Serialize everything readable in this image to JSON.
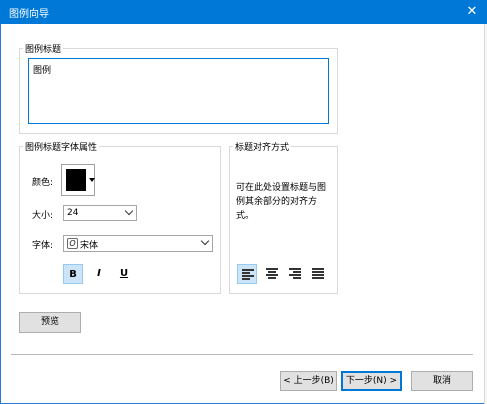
{
  "window": {
    "title": "图例向导",
    "close_icon": "close-icon"
  },
  "legend_title": {
    "group_label": "图例标题",
    "text_value": "图例"
  },
  "font_props": {
    "group_label": "图例标题字体属性",
    "color_label": "颜色:",
    "color_value": "#000000",
    "size_label": "大小:",
    "size_value": "24",
    "font_label": "字体:",
    "font_value": "宋体",
    "bold_label": "B",
    "italic_label": "I",
    "underline_label": "U",
    "bold_active": true
  },
  "alignment": {
    "group_label": "标题对齐方式",
    "description": "可在此处设置标题与图例其余部分的对齐方式。",
    "selected": "left",
    "options": [
      "left",
      "center",
      "right",
      "justify"
    ]
  },
  "buttons": {
    "preview": "预览",
    "back": "< 上一步(B)",
    "next": "下一步(N) >",
    "cancel": "取消"
  }
}
